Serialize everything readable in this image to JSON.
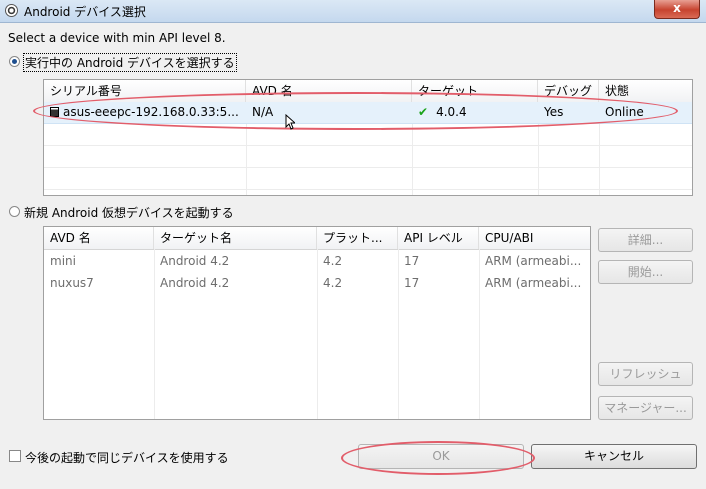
{
  "window": {
    "title": "Android デバイス選択",
    "close_label": "x"
  },
  "heading": "Select a device with min API level 8.",
  "running_section": {
    "radio_label": "実行中の Android デバイスを選択する",
    "columns": [
      "シリアル番号",
      "AVD 名",
      "ターゲット",
      "デバッグ",
      "状態"
    ],
    "rows": [
      {
        "serial": "asus-eeepc-192.168.0.33:5...",
        "avd": "N/A",
        "target": "4.0.4",
        "debug": "Yes",
        "state": "Online"
      }
    ]
  },
  "launch_section": {
    "radio_label": "新規 Android 仮想デバイスを起動する",
    "columns": [
      "AVD 名",
      "ターゲット名",
      "プラット...",
      "API レベル",
      "CPU/ABI"
    ],
    "rows": [
      {
        "name": "mini",
        "target": "Android 4.2",
        "platform": "4.2",
        "api": "17",
        "cpu": "ARM (armeabi..."
      },
      {
        "name": "nuxus7",
        "target": "Android 4.2",
        "platform": "4.2",
        "api": "17",
        "cpu": "ARM (armeabi..."
      }
    ],
    "buttons": {
      "details": "詳細...",
      "start": "開始...",
      "refresh": "リフレッシュ",
      "manager": "マネージャー..."
    }
  },
  "footer": {
    "reuse_checkbox_label": "今後の起動で同じデバイスを使用する",
    "ok_label": "OK",
    "cancel_label": "キャンセル"
  },
  "colors": {
    "annotation": "#e25d6a",
    "selection": "#e5f1fb",
    "check": "#1aa31a"
  }
}
